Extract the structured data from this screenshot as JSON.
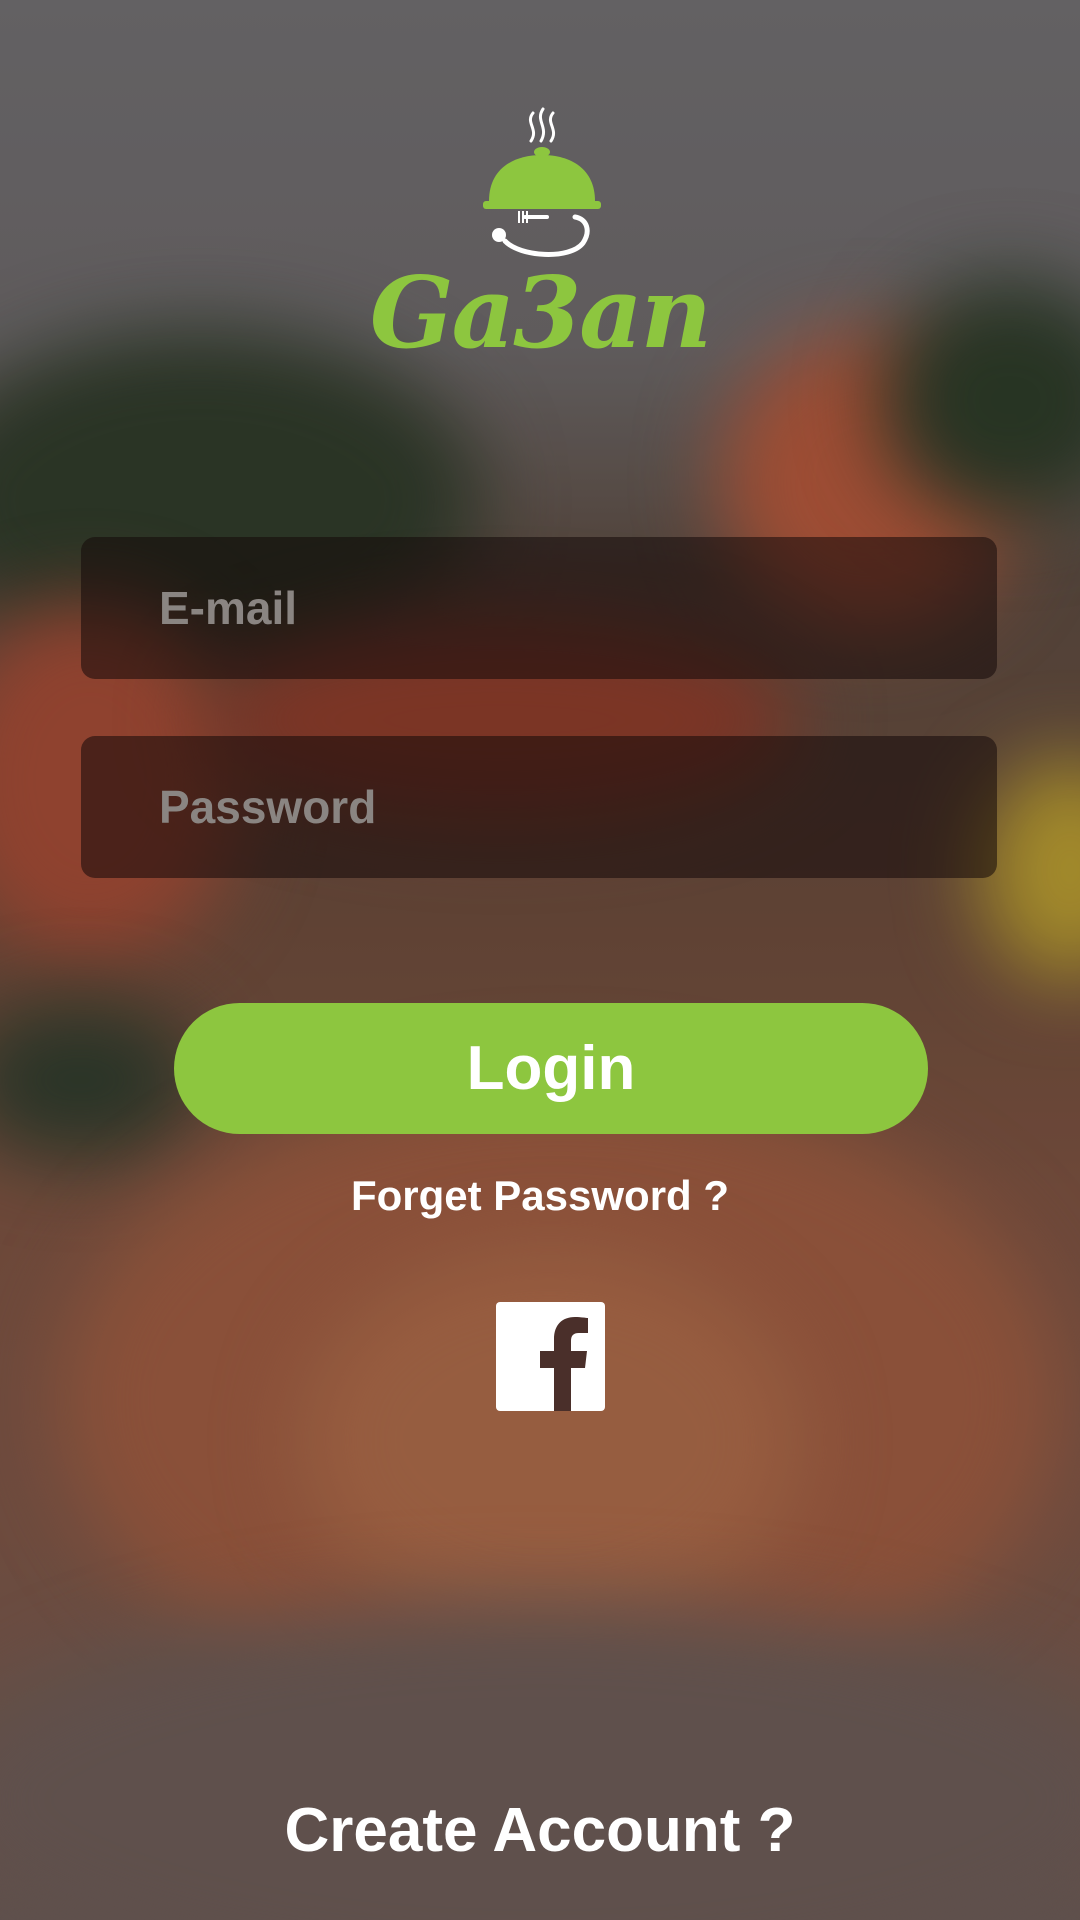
{
  "app": {
    "brand_name": "Ga3an",
    "brand_color": "#8dc63f"
  },
  "login_form": {
    "email_placeholder": "E-mail",
    "email_value": "",
    "password_placeholder": "Password",
    "password_value": "",
    "login_label": "Login",
    "forgot_password_label": "Forget Password ?",
    "social_login_icon": "facebook-icon",
    "create_account_label": "Create Account ?"
  },
  "icons": {
    "logo": "food-cloche-icon",
    "social": "facebook-icon"
  },
  "colors": {
    "accent": "#8dc63f",
    "field_bg": "rgba(20,10,10,0.55)",
    "placeholder": "#8a8582",
    "text": "#ffffff"
  }
}
